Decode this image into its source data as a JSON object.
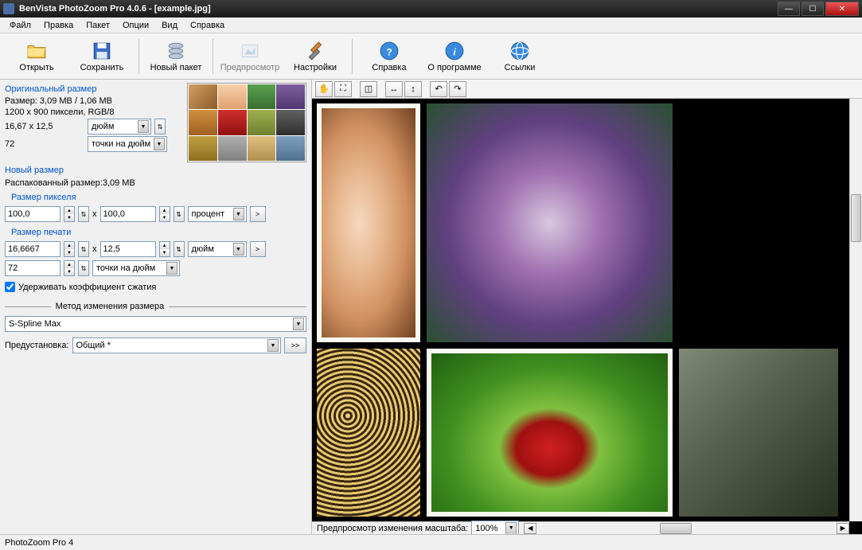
{
  "title": "BenVista PhotoZoom Pro 4.0.6 - [example.jpg]",
  "menu": [
    "Файл",
    "Правка",
    "Пакет",
    "Опции",
    "Вид",
    "Справка"
  ],
  "toolbar": [
    {
      "id": "open",
      "label": "Открыть",
      "icon": "folder"
    },
    {
      "id": "save",
      "label": "Сохранить",
      "icon": "disk"
    },
    {
      "id": "batch",
      "label": "Новый пакет",
      "icon": "stack"
    },
    {
      "id": "preview",
      "label": "Предпросмотр",
      "icon": "image"
    },
    {
      "id": "settings",
      "label": "Настройки",
      "icon": "tools"
    },
    {
      "id": "help",
      "label": "Справка",
      "icon": "help"
    },
    {
      "id": "about",
      "label": "О программе",
      "icon": "info"
    },
    {
      "id": "links",
      "label": "Ссылки",
      "icon": "globe"
    }
  ],
  "orig": {
    "title": "Оригинальный размер",
    "size_line": "Размер: 3,09 MB / 1,06 MB",
    "dims_line": "1200 x 900 пиксели, RGB/8",
    "print_w": "16,67 x 12,5",
    "print_unit": "дюйм",
    "dpi": "72",
    "dpi_unit": "точки на дюйм"
  },
  "newsize": {
    "title": "Новый размер",
    "unpacked": "Распакованный размер:3,09 MB",
    "px_title": "Размер пикселя",
    "px_w": "100,0",
    "px_h": "100,0",
    "px_unit": "процент",
    "print_title": "Размер печати",
    "print_w": "16,6667",
    "print_h": "12,5",
    "print_unit": "дюйм",
    "dpi": "72",
    "dpi_unit": "точки на дюйм",
    "keep_ratio": "Удерживать коэффициент сжатия"
  },
  "method": {
    "title": "Метод изменения размера",
    "value": "S-Spline Max",
    "preset_label": "Предустановка:",
    "preset_value": "Общий *",
    "more": ">>"
  },
  "zoom": {
    "label": "Предпросмотр изменения масштаба:",
    "value": "100%"
  },
  "status": "PhotoZoom Pro 4",
  "x": "x"
}
